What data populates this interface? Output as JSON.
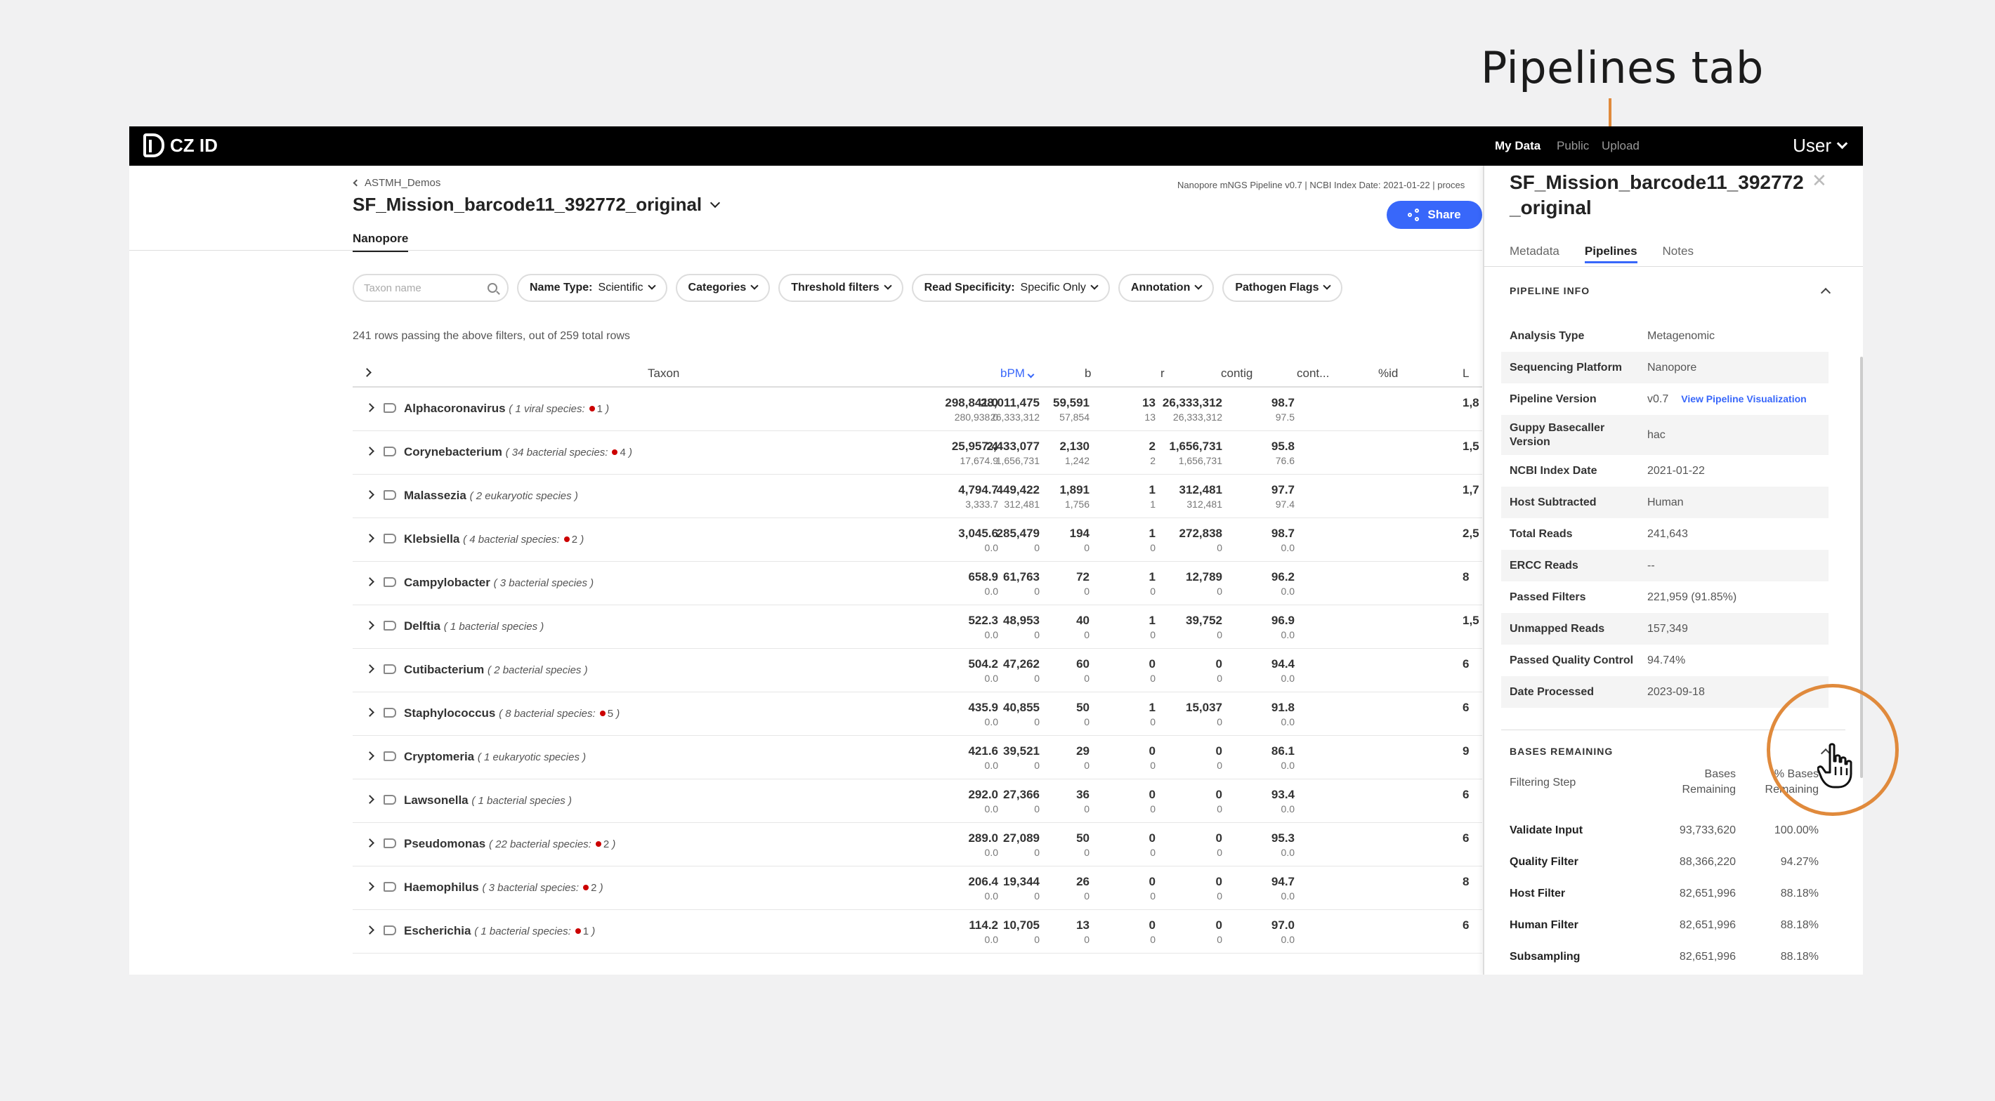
{
  "annotation": {
    "label": "Pipelines tab"
  },
  "topbar": {
    "brand": "CZ ID",
    "nav": [
      "My Data",
      "Public",
      "Upload"
    ],
    "user": "User"
  },
  "header": {
    "breadcrumb": "ASTMH_Demos",
    "sample_title": "SF_Mission_barcode11_392772_original",
    "pipeline_meta": "Nanopore mNGS Pipeline v0.7 | NCBI Index Date: 2021-01-22 | proces",
    "share_label": "Share",
    "tab": "Nanopore"
  },
  "filters": {
    "search_placeholder": "Taxon name",
    "name_type_label": "Name Type:",
    "name_type_value": "Scientific",
    "categories": "Categories",
    "threshold": "Threshold filters",
    "read_spec_label": "Read Specificity:",
    "read_spec_value": "Specific Only",
    "annotation": "Annotation",
    "pathogen_flags": "Pathogen Flags"
  },
  "row_count": "241 rows passing the above filters, out of 259 total rows",
  "table": {
    "headers": [
      "Taxon",
      "bPM",
      "b",
      "r",
      "contig",
      "cont...",
      "%id",
      "L"
    ],
    "rows": [
      {
        "name": "Alphacoronavirus",
        "desc": "1 viral species:",
        "flag": "1",
        "bpm": [
          "298,841.0",
          "280,938.0"
        ],
        "b": [
          "28,011,475",
          "26,333,312"
        ],
        "r": [
          "59,591",
          "57,854"
        ],
        "contig": [
          "13",
          "13"
        ],
        "cont": [
          "26,333,312",
          "26,333,312"
        ],
        "pid": [
          "98.7",
          "97.5"
        ],
        "l": "1,8"
      },
      {
        "name": "Corynebacterium",
        "desc": "34 bacterial species:",
        "flag": "4",
        "bpm": [
          "25,957.4",
          "17,674.9"
        ],
        "b": [
          "2,433,077",
          "1,656,731"
        ],
        "r": [
          "2,130",
          "1,242"
        ],
        "contig": [
          "2",
          "2"
        ],
        "cont": [
          "1,656,731",
          "1,656,731"
        ],
        "pid": [
          "95.8",
          "76.6"
        ],
        "l": "1,5"
      },
      {
        "name": "Malassezia",
        "desc": "2 eukaryotic species",
        "flag": "",
        "bpm": [
          "4,794.7",
          "3,333.7"
        ],
        "b": [
          "449,422",
          "312,481"
        ],
        "r": [
          "1,891",
          "1,756"
        ],
        "contig": [
          "1",
          "1"
        ],
        "cont": [
          "312,481",
          "312,481"
        ],
        "pid": [
          "97.7",
          "97.4"
        ],
        "l": "1,7"
      },
      {
        "name": "Klebsiella",
        "desc": "4 bacterial species:",
        "flag": "2",
        "bpm": [
          "3,045.6",
          "0.0"
        ],
        "b": [
          "285,479",
          "0"
        ],
        "r": [
          "194",
          "0"
        ],
        "contig": [
          "1",
          "0"
        ],
        "cont": [
          "272,838",
          "0"
        ],
        "pid": [
          "98.7",
          "0.0"
        ],
        "l": "2,5"
      },
      {
        "name": "Campylobacter",
        "desc": "3 bacterial species",
        "flag": "",
        "bpm": [
          "658.9",
          "0.0"
        ],
        "b": [
          "61,763",
          "0"
        ],
        "r": [
          "72",
          "0"
        ],
        "contig": [
          "1",
          "0"
        ],
        "cont": [
          "12,789",
          "0"
        ],
        "pid": [
          "96.2",
          "0.0"
        ],
        "l": "8"
      },
      {
        "name": "Delftia",
        "desc": "1 bacterial species",
        "flag": "",
        "bpm": [
          "522.3",
          "0.0"
        ],
        "b": [
          "48,953",
          "0"
        ],
        "r": [
          "40",
          "0"
        ],
        "contig": [
          "1",
          "0"
        ],
        "cont": [
          "39,752",
          "0"
        ],
        "pid": [
          "96.9",
          "0.0"
        ],
        "l": "1,5"
      },
      {
        "name": "Cutibacterium",
        "desc": "2 bacterial species",
        "flag": "",
        "bpm": [
          "504.2",
          "0.0"
        ],
        "b": [
          "47,262",
          "0"
        ],
        "r": [
          "60",
          "0"
        ],
        "contig": [
          "0",
          "0"
        ],
        "cont": [
          "0",
          "0"
        ],
        "pid": [
          "94.4",
          "0.0"
        ],
        "l": "6"
      },
      {
        "name": "Staphylococcus",
        "desc": "8 bacterial species:",
        "flag": "5",
        "bpm": [
          "435.9",
          "0.0"
        ],
        "b": [
          "40,855",
          "0"
        ],
        "r": [
          "50",
          "0"
        ],
        "contig": [
          "1",
          "0"
        ],
        "cont": [
          "15,037",
          "0"
        ],
        "pid": [
          "91.8",
          "0.0"
        ],
        "l": "6"
      },
      {
        "name": "Cryptomeria",
        "desc": "1 eukaryotic species",
        "flag": "",
        "bpm": [
          "421.6",
          "0.0"
        ],
        "b": [
          "39,521",
          "0"
        ],
        "r": [
          "29",
          "0"
        ],
        "contig": [
          "0",
          "0"
        ],
        "cont": [
          "0",
          "0"
        ],
        "pid": [
          "86.1",
          "0.0"
        ],
        "l": "9"
      },
      {
        "name": "Lawsonella",
        "desc": "1 bacterial species",
        "flag": "",
        "bpm": [
          "292.0",
          "0.0"
        ],
        "b": [
          "27,366",
          "0"
        ],
        "r": [
          "36",
          "0"
        ],
        "contig": [
          "0",
          "0"
        ],
        "cont": [
          "0",
          "0"
        ],
        "pid": [
          "93.4",
          "0.0"
        ],
        "l": "6"
      },
      {
        "name": "Pseudomonas",
        "desc": "22 bacterial species:",
        "flag": "2",
        "bpm": [
          "289.0",
          "0.0"
        ],
        "b": [
          "27,089",
          "0"
        ],
        "r": [
          "50",
          "0"
        ],
        "contig": [
          "0",
          "0"
        ],
        "cont": [
          "0",
          "0"
        ],
        "pid": [
          "95.3",
          "0.0"
        ],
        "l": "6"
      },
      {
        "name": "Haemophilus",
        "desc": "3 bacterial species:",
        "flag": "2",
        "bpm": [
          "206.4",
          "0.0"
        ],
        "b": [
          "19,344",
          "0"
        ],
        "r": [
          "26",
          "0"
        ],
        "contig": [
          "0",
          "0"
        ],
        "cont": [
          "0",
          "0"
        ],
        "pid": [
          "94.7",
          "0.0"
        ],
        "l": "8"
      },
      {
        "name": "Escherichia",
        "desc": "1 bacterial species:",
        "flag": "1",
        "bpm": [
          "114.2",
          "0.0"
        ],
        "b": [
          "10,705",
          "0"
        ],
        "r": [
          "13",
          "0"
        ],
        "contig": [
          "0",
          "0"
        ],
        "cont": [
          "0",
          "0"
        ],
        "pid": [
          "97.0",
          "0.0"
        ],
        "l": "6"
      }
    ]
  },
  "panel": {
    "title": "SF_Mission_barcode11_392772_original",
    "tabs": [
      "Metadata",
      "Pipelines",
      "Notes"
    ],
    "pipeline_info_heading": "PIPELINE INFO",
    "info": [
      {
        "k": "Analysis Type",
        "v": "Metagenomic"
      },
      {
        "k": "Sequencing Platform",
        "v": "Nanopore"
      },
      {
        "k": "Pipeline Version",
        "v": "v0.7",
        "link": "View Pipeline Visualization"
      },
      {
        "k": "Guppy Basecaller Version",
        "v": "hac"
      },
      {
        "k": "NCBI Index Date",
        "v": "2021-01-22"
      },
      {
        "k": "Host Subtracted",
        "v": "Human"
      },
      {
        "k": "Total Reads",
        "v": "241,643"
      },
      {
        "k": "ERCC Reads",
        "v": "--"
      },
      {
        "k": "Passed Filters",
        "v": "221,959 (91.85%)"
      },
      {
        "k": "Unmapped Reads",
        "v": "157,349"
      },
      {
        "k": "Passed Quality Control",
        "v": "94.74%"
      },
      {
        "k": "Date Processed",
        "v": "2023-09-18"
      }
    ],
    "bases_heading": "BASES REMAINING",
    "bases_cols": [
      "Filtering Step",
      "Bases Remaining",
      "% Bases Remaining"
    ],
    "bases_rows": [
      {
        "k": "Validate Input",
        "a": "93,733,620",
        "b": "100.00%"
      },
      {
        "k": "Quality Filter",
        "a": "88,366,220",
        "b": "94.27%"
      },
      {
        "k": "Host Filter",
        "a": "82,651,996",
        "b": "88.18%"
      },
      {
        "k": "Human Filter",
        "a": "82,651,996",
        "b": "88.18%"
      },
      {
        "k": "Subsampling",
        "a": "82,651,996",
        "b": "88.18%"
      }
    ]
  },
  "colors": {
    "accent": "#3867fa",
    "annotation": "#e08a3c",
    "flag": "#cc0000"
  }
}
